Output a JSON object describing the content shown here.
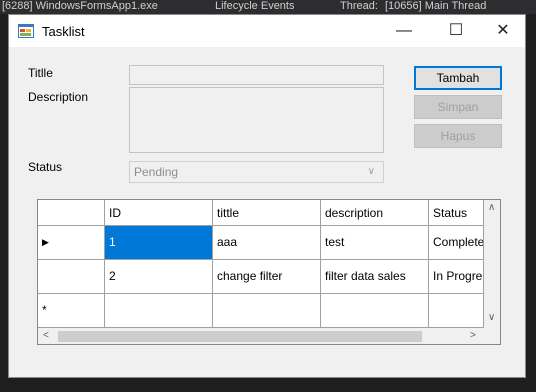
{
  "ide_bar": {
    "process": "[6288] WindowsFormsApp1.exe",
    "events": "Lifecycle Events",
    "thread_label": "Thread:",
    "thread_value": "[10656] Main Thread"
  },
  "window": {
    "title": "Tasklist",
    "controls": {
      "minimize": "—",
      "maximize": "☐",
      "close": "✕"
    }
  },
  "form": {
    "title_label": "Titlle",
    "title_value": "",
    "description_label": "Description",
    "description_value": "",
    "status_label": "Status",
    "status_value": "Pending"
  },
  "buttons": {
    "add": "Tambah",
    "save": "Simpan",
    "delete": "Hapus"
  },
  "grid": {
    "columns": [
      "ID",
      "tittle",
      "description",
      "Status"
    ],
    "rows": [
      {
        "id": "1",
        "title": "aaa",
        "description": "test",
        "status": "Complete"
      },
      {
        "id": "2",
        "title": "change filter",
        "description": "filter data sales",
        "status": "In Progress"
      }
    ],
    "current_row_marker": "▶",
    "new_row_marker": "*"
  },
  "icons": {
    "app": "window-app-icon",
    "combo_arrow": "chevron-down-icon",
    "scroll_up": "scroll-up-icon",
    "scroll_down": "scroll-down-icon",
    "scroll_left": "scroll-left-icon",
    "scroll_right": "scroll-right-icon"
  },
  "colors": {
    "accent": "#0078d7",
    "selection": "#0078d7"
  }
}
